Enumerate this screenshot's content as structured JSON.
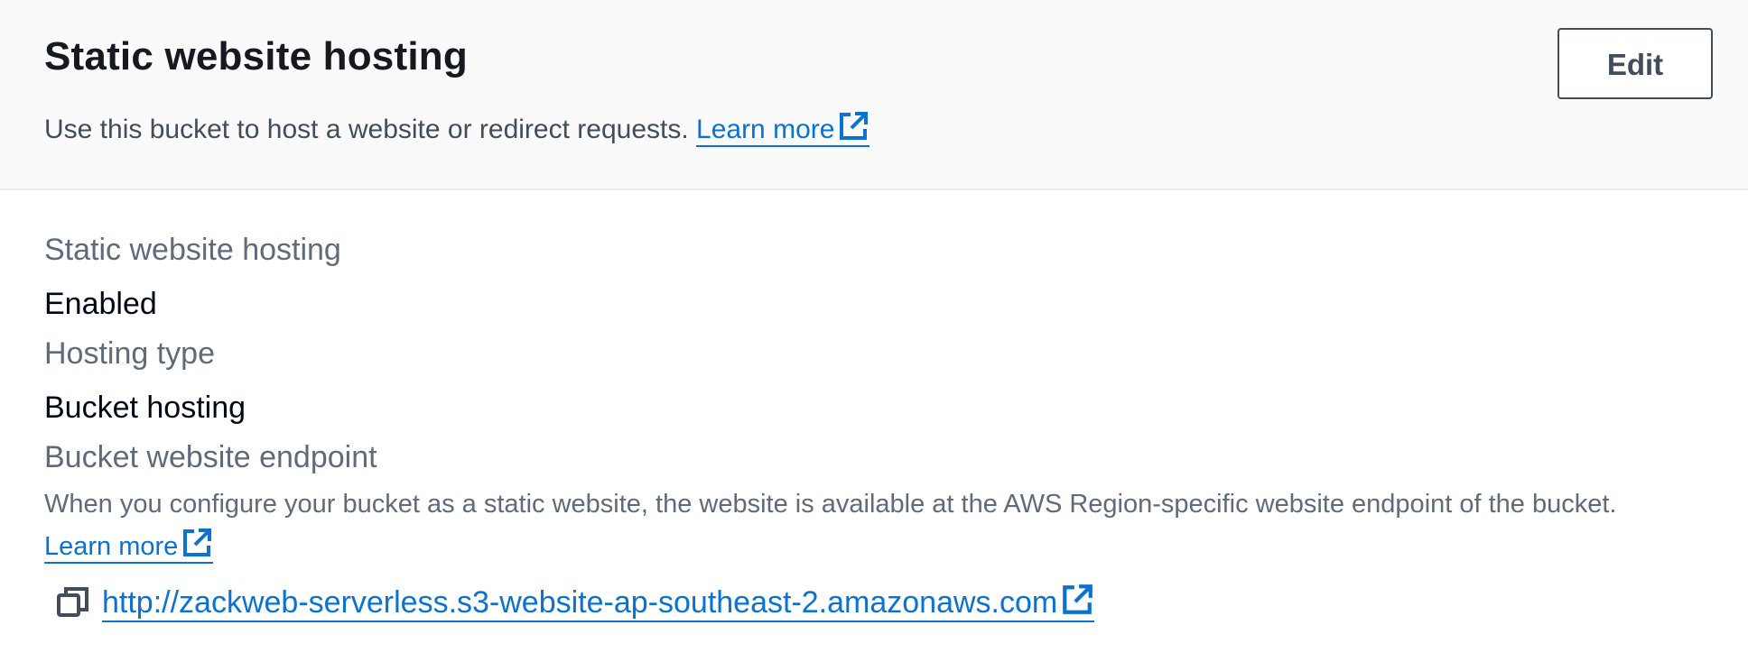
{
  "header": {
    "title": "Static website hosting",
    "description": "Use this bucket to host a website or redirect requests.",
    "learn_more": "Learn more",
    "edit_label": "Edit"
  },
  "details": {
    "hosting_label": "Static website hosting",
    "hosting_value": "Enabled",
    "type_label": "Hosting type",
    "type_value": "Bucket hosting",
    "endpoint_label": "Bucket website endpoint",
    "endpoint_description": "When you configure your bucket as a static website, the website is available at the AWS Region-specific website endpoint of the bucket.",
    "endpoint_learn_more": "Learn more",
    "endpoint_url": "http://zackweb-serverless.s3-website-ap-southeast-2.amazonaws.com"
  },
  "icons": {
    "external": "external-link-icon",
    "copy": "copy-icon"
  },
  "colors": {
    "link": "#0972d3",
    "header_bg": "#fafafa",
    "title": "#16191f",
    "label": "#5f6b7a"
  }
}
